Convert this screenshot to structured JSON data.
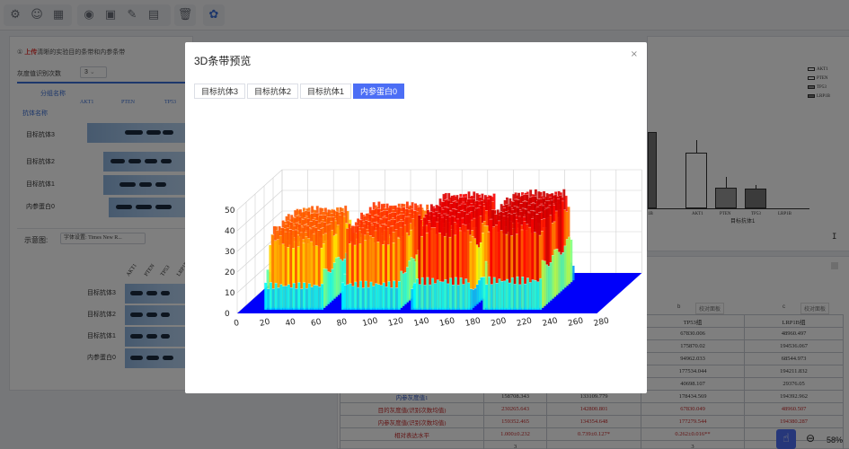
{
  "toolbar": {
    "icons": [
      "chart-settings-icon",
      "user-icon",
      "image-chart-icon",
      "eye-icon",
      "image-doc-icon",
      "edit-doc-icon",
      "table-edit-icon",
      "trash-icon",
      "palette-icon"
    ]
  },
  "left": {
    "hint_prefix": "①",
    "hint_hl": "上传",
    "hint_rest": "清晰的实验目的条带和内参条带",
    "count_label": "灰度值识别次数",
    "count_value": "3",
    "group_label": "分组名称",
    "antibody_label": "抗体名称",
    "col_headers": [
      "AKT1",
      "PTEN",
      "TP53"
    ],
    "rows": [
      "目标抗体3",
      "目标抗体2",
      "目标抗体1",
      "内参蛋白0"
    ],
    "diagram_title": "示意图:",
    "font_setting": "字体设置: Times New R...",
    "diagram_cols": [
      "AKT1",
      "PTEN",
      "TP53",
      "LRP1B"
    ]
  },
  "right_chart": {
    "legend": [
      "AKT1",
      "PTEN",
      "TP53",
      "LRP1B"
    ],
    "x_labels": [
      "1B",
      "AKT1",
      "PTEN",
      "TP53",
      "LRP1B"
    ],
    "x_title": "目标抗体1",
    "bar_values": [
      1.0,
      0.73,
      0.27,
      0.26
    ],
    "cursor_text": "I"
  },
  "table": {
    "header_letters": [
      "b",
      "c"
    ],
    "header_buttons": [
      "校对面板",
      "校对面板"
    ],
    "col_labels": [
      "TP53组",
      "LRP1B组"
    ],
    "rows": [
      {
        "label": "",
        "c1": "",
        "c2": "",
        "c3": "67830.006",
        "c4": "48960.497",
        "red": false
      },
      {
        "label": "",
        "c1": "",
        "c2": "",
        "c3": "175870.02",
        "c4": "194536.067",
        "red": false
      },
      {
        "label": "",
        "c1": "",
        "c2": "",
        "c3": "94962.033",
        "c4": "68544.973",
        "red": false
      },
      {
        "label": "",
        "c1": "",
        "c2": "",
        "c3": "177534.044",
        "c4": "194211.832",
        "red": false
      },
      {
        "label": "",
        "c1": "",
        "c2": "",
        "c3": "40698.107",
        "c4": "29376.05",
        "red": false
      },
      {
        "label": "内参灰度值1",
        "c1": "158708.343",
        "c2": "133109.779",
        "c3": "178434.569",
        "c4": "194392.962",
        "red": false
      },
      {
        "label": "目的灰度值(识别次数均值)",
        "c1": "230265.643",
        "c2": "142800.801",
        "c3": "67830.049",
        "c4": "48960.507",
        "red": true
      },
      {
        "label": "内参灰度值(识别次数均值)",
        "c1": "159352.465",
        "c2": "134354.648",
        "c3": "177279.544",
        "c4": "194380.287",
        "red": true
      },
      {
        "label": "相对表达水平",
        "c1": "1.000±0.232",
        "c2": "0.739±0.127*",
        "c3": "0.262±0.016**",
        "c4": "",
        "red": true
      },
      {
        "label": "",
        "c1": "3",
        "c2": "",
        "c3": "3",
        "c4": "",
        "red": false
      }
    ]
  },
  "modal": {
    "title": "3D条带预览",
    "close": "×",
    "tabs": [
      "目标抗体3",
      "目标抗体2",
      "目标抗体1",
      "内参蛋白0"
    ],
    "active_tab": 3
  },
  "chart_data": {
    "type": "surface3d",
    "x_ticks": [
      "0",
      "20",
      "40",
      "60",
      "80",
      "100",
      "120",
      "140",
      "160",
      "180",
      "200",
      "220",
      "240",
      "260",
      "280"
    ],
    "z_ticks": [
      "0",
      "10",
      "20",
      "30",
      "40",
      "50"
    ],
    "x_range": [
      0,
      280
    ],
    "z_range": [
      0,
      50
    ],
    "bands": [
      {
        "x_center": 40,
        "peak": 38
      },
      {
        "x_center": 100,
        "peak": 40
      },
      {
        "x_center": 155,
        "peak": 45
      },
      {
        "x_center": 210,
        "peak": 46
      }
    ],
    "colormap": "jet",
    "grid": true
  },
  "controls": {
    "hand_icon": "hand-pointer-icon",
    "zoom_icon": "zoom-out-icon",
    "zoom_value": "58%"
  }
}
